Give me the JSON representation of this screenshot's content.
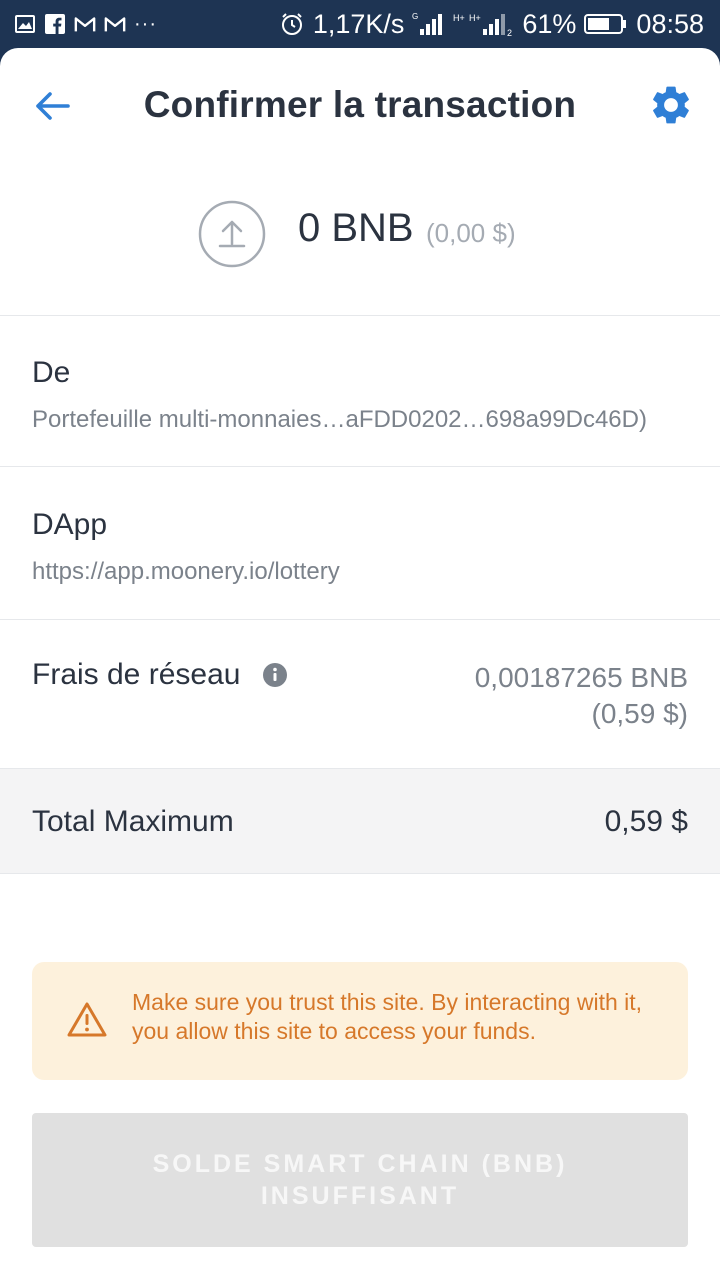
{
  "status_bar": {
    "speed": "1,17K/s",
    "battery": "61%",
    "time": "08:58",
    "left_icons": [
      "image-icon",
      "facebook-icon",
      "gmail-icon",
      "gmail-icon"
    ],
    "more": "···",
    "right_icons": [
      "alarm-icon",
      "signal-icon",
      "signal-icon",
      "battery-icon"
    ]
  },
  "header": {
    "title": "Confirmer la transaction",
    "back_icon": "arrow-left-icon",
    "settings_icon": "gear-icon"
  },
  "amount": {
    "value": "0 BNB",
    "fiat": "(0,00 $)",
    "icon": "upload-circle-icon"
  },
  "from": {
    "label": "De",
    "value": "Portefeuille multi-monnaies…aFDD0202…698a99Dc46D)"
  },
  "dapp": {
    "label": "DApp",
    "value": "https://app.moonery.io/lottery"
  },
  "fee": {
    "label": "Frais de réseau",
    "value": "0,00187265 BNB",
    "fiat": "(0,59 $)",
    "icon": "info-icon"
  },
  "total": {
    "label": "Total Maximum",
    "value": "0,59 $"
  },
  "warning": {
    "text": "Make sure you trust this site. By interacting with it, you allow this site to access your funds.",
    "icon": "warning-triangle-icon"
  },
  "cta": {
    "label": "SOLDE SMART CHAIN (BNB) INSUFFISANT"
  },
  "colors": {
    "accent": "#2f7fd6",
    "status_bar": "#1e3453",
    "warning_text": "#d6782a",
    "warning_bg": "#fdf1dc"
  }
}
